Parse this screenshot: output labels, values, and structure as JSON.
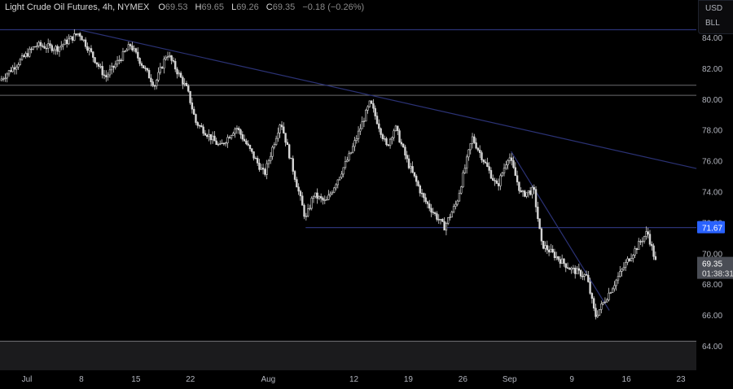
{
  "header": {
    "title": "Light Crude Oil Futures, 4h, NYMEX",
    "open_label": "O",
    "open": "69.53",
    "high_label": "H",
    "high": "69.65",
    "low_label": "L",
    "low": "69.26",
    "close_label": "C",
    "close": "69.35",
    "change": "−0.18 (−0.26%)"
  },
  "unit_menu": {
    "currency": "USD",
    "unit": "BLL"
  },
  "chart_data": {
    "type": "candlestick",
    "title": "Light Crude Oil Futures, 4h, NYMEX",
    "ylim": [
      63,
      85
    ],
    "y_ticks": [
      "84.00",
      "82.00",
      "80.00",
      "78.00",
      "76.00",
      "74.00",
      "72.00",
      "70.00",
      "68.00",
      "66.00",
      "64.00"
    ],
    "y_tick_values": [
      84,
      82,
      80,
      78,
      76,
      74,
      72,
      70,
      68,
      66,
      64
    ],
    "x_ticks": [
      {
        "label": "Jul",
        "day": 0
      },
      {
        "label": "8",
        "day": 7
      },
      {
        "label": "15",
        "day": 14
      },
      {
        "label": "22",
        "day": 21
      },
      {
        "label": "Aug",
        "day": 31
      },
      {
        "label": "12",
        "day": 42
      },
      {
        "label": "19",
        "day": 49
      },
      {
        "label": "26",
        "day": 56
      },
      {
        "label": "Sep",
        "day": 62
      },
      {
        "label": "9",
        "day": 70
      },
      {
        "label": "16",
        "day": 77
      },
      {
        "label": "23",
        "day": 84
      }
    ],
    "xlim_days": [
      -3.5,
      85.9
    ],
    "price_path_day_price": [
      [
        -3.5,
        81.2
      ],
      [
        1.2,
        83.5
      ],
      [
        3.9,
        83.3
      ],
      [
        6.7,
        84.3
      ],
      [
        10.1,
        81.4
      ],
      [
        13.3,
        83.5
      ],
      [
        16.4,
        80.9
      ],
      [
        18,
        83.0
      ],
      [
        20.6,
        80.6
      ],
      [
        21.7,
        78.5
      ],
      [
        24.8,
        76.9
      ],
      [
        26.9,
        78.2
      ],
      [
        30.5,
        75.1
      ],
      [
        32.6,
        78.6
      ],
      [
        35.8,
        72.2
      ],
      [
        36.8,
        73.8
      ],
      [
        38.4,
        73.3
      ],
      [
        41.5,
        76.4
      ],
      [
        44.1,
        79.8
      ],
      [
        46.2,
        76.9
      ],
      [
        47.3,
        78.2
      ],
      [
        48.9,
        75.9
      ],
      [
        51,
        73.5
      ],
      [
        53.6,
        71.7
      ],
      [
        55.2,
        73.3
      ],
      [
        57.2,
        77.5
      ],
      [
        60.4,
        74.3
      ],
      [
        61.9,
        76.4
      ],
      [
        63.5,
        73.8
      ],
      [
        65.1,
        74.1
      ],
      [
        66.1,
        70.6
      ],
      [
        69.8,
        69.0
      ],
      [
        71.9,
        68.5
      ],
      [
        73,
        65.9
      ],
      [
        74.5,
        67.2
      ],
      [
        77.1,
        69.5
      ],
      [
        79.7,
        71.4
      ],
      [
        80.8,
        69.35
      ]
    ],
    "last_price": "69.35",
    "countdown": "01:38:31",
    "levels": [
      {
        "name": "resistance-top",
        "price": 84.5,
        "label": ""
      },
      {
        "name": "resistance-zone-upper",
        "price": 80.9
      },
      {
        "name": "resistance-zone-lower",
        "price": 80.25
      },
      {
        "name": "support",
        "price": 71.67,
        "label": "71.67"
      },
      {
        "name": "support-bottom",
        "price": 64.3
      }
    ],
    "trendlines": [
      {
        "name": "major-down-trendline",
        "from": [
          6.7,
          84.5
        ],
        "to": [
          86,
          75.5
        ]
      },
      {
        "name": "minor-down-trendline",
        "from": [
          62.2,
          76.6
        ],
        "to": [
          74.8,
          66.3
        ]
      }
    ],
    "colors": {
      "background": "#000000",
      "candle": "#d6d6d6",
      "line": "#2b3275",
      "label_bg": "#2962ff",
      "last_bg": "#4a4d55",
      "zone": "#1b1b1d"
    }
  }
}
